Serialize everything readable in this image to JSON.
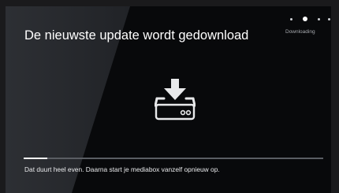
{
  "header": {
    "title": "De nieuwste update wordt gedownload"
  },
  "steps": {
    "total": 4,
    "current": 2,
    "status_label": "Downloading"
  },
  "main": {
    "icon": "download-to-box-icon"
  },
  "progress": {
    "value": 0.08,
    "message": "Dat duurt heel even. Daarna start je mediabox vanzelf opnieuw op."
  },
  "colors": {
    "background": "#08090b",
    "text": "#ffffff",
    "progress_fill": "#ffffff",
    "progress_track": "#5a5d63"
  }
}
